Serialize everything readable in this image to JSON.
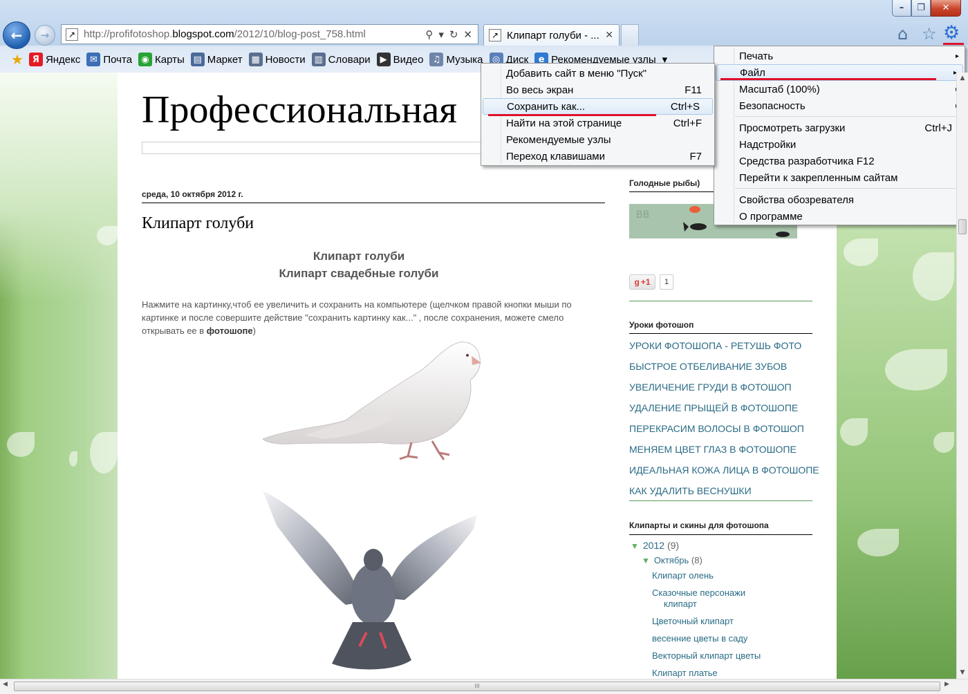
{
  "window": {
    "buttons": {
      "minimize": "–",
      "maximize": "❐",
      "close": "✕"
    }
  },
  "toolbar": {
    "back_glyph": "←",
    "forward_glyph": "→",
    "favicon_glyph": "↗",
    "address_prefix": "http://profifotoshop.",
    "address_domain": "blogspot.com",
    "address_path": "/2012/10/blog-post_758.html",
    "search_glyph": "⚲",
    "dropdown_glyph": "▾",
    "refresh_glyph": "↻",
    "stop_glyph": "✕",
    "tab_title": "Клипарт голуби - ...",
    "tab_close": "✕",
    "home_glyph": "⌂",
    "favorites_glyph": "☆",
    "tools_glyph": "⚙"
  },
  "favbar": {
    "star_glyph": "★",
    "items": [
      {
        "label": "Яндекс",
        "icon": "Я",
        "color": "#e51b23"
      },
      {
        "label": "Почта",
        "icon": "✉",
        "color": "#3d6fb6"
      },
      {
        "label": "Карты",
        "icon": "◉",
        "color": "#2aa335"
      },
      {
        "label": "Маркет",
        "icon": "▤",
        "color": "#4a6a9a"
      },
      {
        "label": "Новости",
        "icon": "▦",
        "color": "#5a6f8f"
      },
      {
        "label": "Словари",
        "icon": "▥",
        "color": "#5a6f8f"
      },
      {
        "label": "Видео",
        "icon": "▶",
        "color": "#333333"
      },
      {
        "label": "Музыка",
        "icon": "♫",
        "color": "#6f86a8"
      },
      {
        "label": "Диск",
        "icon": "◎",
        "color": "#5b7fb8"
      },
      {
        "label": "Рекомендуемые узлы",
        "icon": "e",
        "color": "#2f79d0"
      }
    ],
    "more_glyph": "▾"
  },
  "page": {
    "blog_title": "Профессиональная",
    "date": "среда, 10 октября 2012 г.",
    "post_title": "Клипарт голуби",
    "heading1": "Клипарт голуби",
    "heading2": "Клипарт свадебные голуби",
    "body_text": "Нажмите на картинку,чтоб ее увеличить и сохранить на компьютере (щелчком правой кнопки мыши по картинке и после совершите действие \"сохранить картинку как...\" , после сохранения, можете смело открывать ее в ",
    "body_bold": "фотошопе",
    "body_end": ")"
  },
  "sidebar": {
    "fish_heading": "Голодные рыбы)",
    "fish_watermark": "BB",
    "gplus_label": "+1",
    "gplus_count": "1",
    "lessons_heading": "Уроки фотошоп",
    "lessons": [
      "УРОКИ ФОТОШОПА - РЕТУШЬ ФОТО",
      "БЫСТРОЕ ОТБЕЛИВАНИЕ ЗУБОВ",
      "УВЕЛИЧЕНИЕ ГРУДИ В ФОТОШОП",
      "УДАЛЕНИЕ ПРЫЩЕЙ В ФОТОШОПЕ",
      "ПЕРЕКРАСИМ ВОЛОСЫ В ФОТОШОП",
      "МЕНЯЕМ ЦВЕТ ГЛАЗ В ФОТОШОПЕ",
      "ИДЕАЛЬНАЯ КОЖА ЛИЦА В ФОТОШОПЕ",
      "КАК УДАЛИТЬ ВЕСНУШКИ"
    ],
    "clipart_heading": "Клипарты и скины для фотошопа",
    "archive_year": "2012",
    "archive_year_count": "(9)",
    "archive_month": "Октябрь",
    "archive_month_count": "(8)",
    "archive_posts": [
      "Клипарт олень",
      "Сказочные персонажи",
      "клипарт",
      "Цветочный клипарт",
      "весенние цветы в саду",
      "Векторный клипарт цветы",
      "Клипарт платье"
    ]
  },
  "tools_menu": {
    "items": [
      {
        "label": "Печать",
        "key": "",
        "arrow": "▸"
      },
      {
        "label": "Файл",
        "key": "",
        "arrow": "▸"
      },
      {
        "label": "Масштаб (100%)",
        "key": "",
        "arrow": "▸"
      },
      {
        "label": "Безопасность",
        "key": "",
        "arrow": "▸"
      },
      {
        "label": "Просмотреть загрузки",
        "key": "Ctrl+J",
        "arrow": ""
      },
      {
        "label": "Надстройки",
        "key": "",
        "arrow": ""
      },
      {
        "label": "Средства разработчика F12",
        "key": "",
        "arrow": ""
      },
      {
        "label": "Перейти к закрепленным сайтам",
        "key": "",
        "arrow": ""
      },
      {
        "label": "Свойства обозревателя",
        "key": "",
        "arrow": ""
      },
      {
        "label": "О программе",
        "key": "",
        "arrow": ""
      }
    ]
  },
  "file_menu": {
    "items": [
      {
        "label": "Добавить сайт в меню \"Пуск\"",
        "key": ""
      },
      {
        "label": "Во весь экран",
        "key": "F11"
      },
      {
        "label": "Сохранить как...",
        "key": "Ctrl+S"
      },
      {
        "label": "Найти на этой странице",
        "key": "Ctrl+F"
      },
      {
        "label": "Рекомендуемые узлы",
        "key": ""
      },
      {
        "label": "Переход клавишами",
        "key": "F7"
      }
    ]
  },
  "scrollbar": {
    "up": "▲",
    "down": "▼",
    "left": "◀",
    "right": "▶",
    "grip": "III"
  },
  "colors": {
    "accent_red": "#e0102b",
    "link": "#2a6b86",
    "side_line": "#5a9a5a"
  }
}
